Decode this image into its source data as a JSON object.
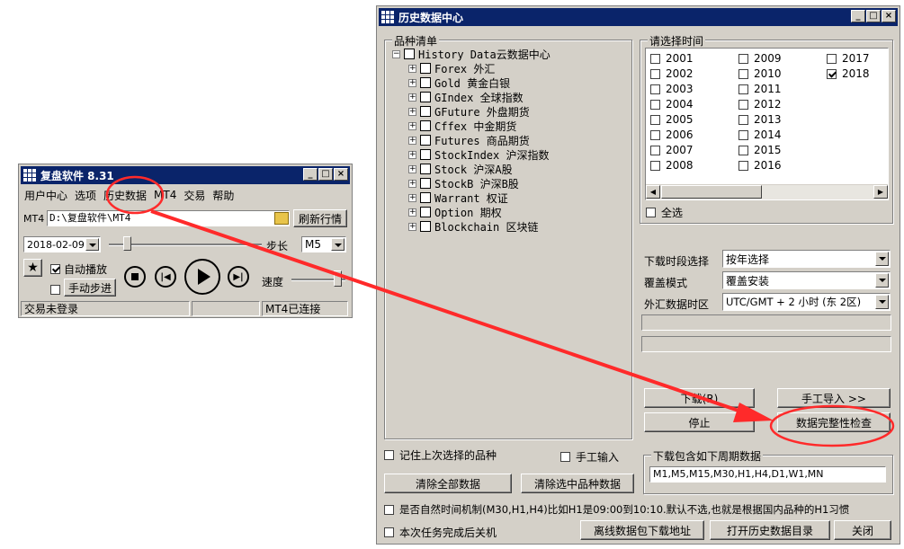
{
  "small_window": {
    "title": "复盘软件 8.31",
    "menu": [
      "用户中心",
      "选项",
      "历史数据",
      "MT4",
      "交易",
      "帮助"
    ],
    "mt4_label": "MT4",
    "mt4_path": "D:\\复盘软件\\MT4",
    "refresh_button": "刷新行情",
    "date_value": "2018-02-09",
    "step_label": "步长",
    "step_value": "M5",
    "auto_play_label": "自动播放",
    "manual_step_button": "手动步进",
    "speed_label": "速度",
    "status_left": "交易未登录",
    "status_right": "MT4已连接"
  },
  "main_window": {
    "title": "历史数据中心",
    "product_group_label": "品种清单",
    "tree_root": "History Data云数据中心",
    "tree_items": [
      "Forex 外汇",
      "Gold 黄金白银",
      "GIndex 全球指数",
      "GFuture 外盘期货",
      "Cffex 中金期货",
      "Futures 商品期货",
      "StockIndex 沪深指数",
      "Stock 沪深A股",
      "StockB 沪深B股",
      "Warrant 权证",
      "Option 期权",
      "Blockchain 区块链"
    ],
    "time_group_label": "请选择时间",
    "years": [
      {
        "label": "2001",
        "checked": false
      },
      {
        "label": "2002",
        "checked": false
      },
      {
        "label": "2003",
        "checked": false
      },
      {
        "label": "2004",
        "checked": false
      },
      {
        "label": "2005",
        "checked": false
      },
      {
        "label": "2006",
        "checked": false
      },
      {
        "label": "2007",
        "checked": false
      },
      {
        "label": "2008",
        "checked": false
      },
      {
        "label": "2009",
        "checked": false
      },
      {
        "label": "2010",
        "checked": false
      },
      {
        "label": "2011",
        "checked": false
      },
      {
        "label": "2012",
        "checked": false
      },
      {
        "label": "2013",
        "checked": false
      },
      {
        "label": "2014",
        "checked": false
      },
      {
        "label": "2015",
        "checked": false
      },
      {
        "label": "2016",
        "checked": false
      },
      {
        "label": "2017",
        "checked": false
      },
      {
        "label": "2018",
        "checked": true
      }
    ],
    "select_all_label": "全选",
    "download_period_label": "下载时段选择",
    "download_period_value": "按年选择",
    "cover_mode_label": "覆盖模式",
    "cover_mode_value": "覆盖安装",
    "forex_tz_label": "外汇数据时区",
    "forex_tz_value": "UTC/GMT + 2 小时 (东 2区)",
    "download_button": "下载(R)",
    "manual_import_button": "手工导入 >>",
    "stop_button": "停止",
    "integrity_check_button": "数据完整性检查",
    "remember_label": "记住上次选择的品种",
    "manual_input_label": "手工输入",
    "clear_all_button": "清除全部数据",
    "clear_selected_button": "清除选中品种数据",
    "period_group_label": "下载包含如下周期数据",
    "period_value": "M1,M5,M15,M30,H1,H4,D1,W1,MN",
    "natural_time_label": "是否自然时间机制(M30,H1,H4)比如H1是09:00到10:10.默认不选,也就是根据国内品种的H1习惯",
    "shutdown_label": "本次任务完成后关机",
    "offline_button": "离线数据包下载地址",
    "open_dir_button": "打开历史数据目录",
    "close_button": "关闭"
  },
  "colors": {
    "titlebar": "#0a246a",
    "face": "#d4d0c8",
    "annotation": "#ff2a2a"
  }
}
